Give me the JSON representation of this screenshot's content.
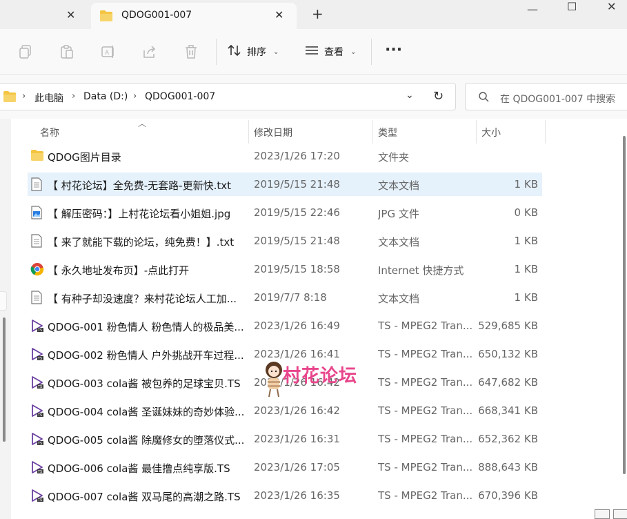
{
  "tabs": {
    "active_title": "QDOG001-007"
  },
  "toolbar": {
    "sort_label": "排序",
    "view_label": "查看"
  },
  "breadcrumb": {
    "this_pc": "此电脑",
    "drive": "Data (D:)",
    "folder": "QDOG001-007"
  },
  "search": {
    "placeholder": "在 QDOG001-007 中搜索"
  },
  "columns": {
    "name": "名称",
    "modified": "修改日期",
    "type": "类型",
    "size": "大小"
  },
  "files": [
    {
      "name": "QDOG图片目录",
      "date": "2023/1/26 17:20",
      "type": "文件夹",
      "size": "",
      "icon": "folder-icon"
    },
    {
      "name": "【 村花论坛】全免费-无套路-更新快.txt",
      "date": "2019/5/15 21:48",
      "type": "文本文档",
      "size": "1 KB",
      "icon": "text-file-icon"
    },
    {
      "name": "【 解压密码：】上村花论坛看小姐姐.jpg",
      "date": "2019/5/15 22:46",
      "type": "JPG 文件",
      "size": "0 KB",
      "icon": "image-file-icon"
    },
    {
      "name": "【 来了就能下载的论坛，纯免费！】.txt",
      "date": "2019/5/15 21:48",
      "type": "文本文档",
      "size": "1 KB",
      "icon": "text-file-icon"
    },
    {
      "name": "【 永久地址发布页】-点此打开",
      "date": "2019/5/15 18:58",
      "type": "Internet 快捷方式",
      "size": "1 KB",
      "icon": "chrome-icon"
    },
    {
      "name": "【 有种子却没速度？来村花论坛人工加...",
      "date": "2019/7/7 8:18",
      "type": "文本文档",
      "size": "1 KB",
      "icon": "text-file-icon"
    },
    {
      "name": "QDOG-001 粉色情人 粉色情人的极品美...",
      "date": "2023/1/26 16:49",
      "type": "TS - MPEG2 Tran...",
      "size": "529,685 KB",
      "icon": "video-file-icon"
    },
    {
      "name": "QDOG-002 粉色情人 户外挑战开车过程...",
      "date": "2023/1/26 16:41",
      "type": "TS - MPEG2 Tran...",
      "size": "650,132 KB",
      "icon": "video-file-icon"
    },
    {
      "name": "QDOG-003 cola酱 被包养的足球宝贝.TS",
      "date": "2023/1/26 16:42",
      "type": "TS - MPEG2 Tran...",
      "size": "647,682 KB",
      "icon": "video-file-icon"
    },
    {
      "name": "QDOG-004 cola酱 圣诞妹妹的奇妙体验...",
      "date": "2023/1/26 16:42",
      "type": "TS - MPEG2 Tran...",
      "size": "668,341 KB",
      "icon": "video-file-icon"
    },
    {
      "name": "QDOG-005 cola酱 除魔修女的堕落仪式...",
      "date": "2023/1/26 16:31",
      "type": "TS - MPEG2 Tran...",
      "size": "652,362 KB",
      "icon": "video-file-icon"
    },
    {
      "name": "QDOG-006 cola酱 最佳撸点纯享版.TS",
      "date": "2023/1/26 17:05",
      "type": "TS - MPEG2 Tran...",
      "size": "888,643 KB",
      "icon": "video-file-icon"
    },
    {
      "name": "QDOG-007 cola酱 双马尾的高潮之路.TS",
      "date": "2023/1/26 16:35",
      "type": "TS - MPEG2 Tran...",
      "size": "670,396 KB",
      "icon": "video-file-icon"
    }
  ],
  "selected_index": 1,
  "watermark": {
    "text": "村花论坛"
  },
  "colors": {
    "selection": "#e5f1fb",
    "folder": "#f4c542",
    "video_icon": "#6b3fa0",
    "watermark": "#e8468c"
  }
}
